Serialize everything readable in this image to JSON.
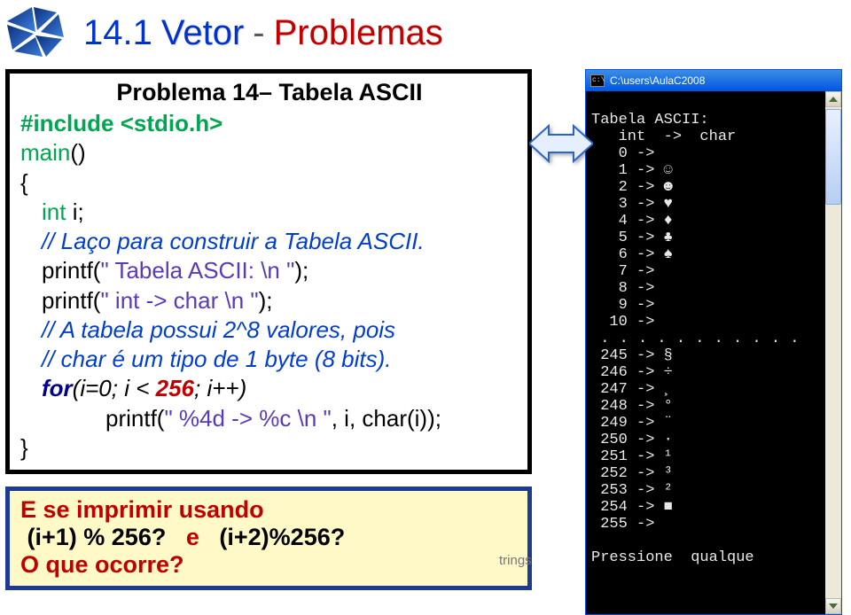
{
  "header": {
    "section_num": "14.1",
    "word_vetor": "Vetor",
    "dash": "-",
    "word_prob": "Problemas"
  },
  "code": {
    "problem_title": "Problema 14– Tabela ASCII",
    "include": "#include <stdio.h>",
    "main_kw": "main",
    "main_paren": "()",
    "brace_open": "{",
    "int_kw": "int",
    "int_var": " i;",
    "cm1": "// Laço para construir a Tabela ASCII.",
    "p1a": "printf(",
    "p1s": "\" Tabela ASCII: \\n \"",
    "p1b": ");",
    "p2a": "printf(",
    "p2s": "\"   int -> char \\n \"",
    "p2b": ");",
    "cm2": "// A tabela possui 2^8 valores, pois",
    "cm3": "// char é um tipo de 1 byte (8 bits).",
    "for_a": "for",
    "for_paren_open": "(i=0; i < ",
    "for_num": "256",
    "for_paren_close": "; i++)",
    "p3a": "printf(",
    "p3s": "\" %4d -> %c \\n \"",
    "p3b": ", i, char(i));",
    "brace_close": "}"
  },
  "question": {
    "l1a": "E se imprimir usando",
    "l2a": "(i+1) % 256?",
    "l2b": "e",
    "l2c": "(i+2)%256?",
    "l3": "O que ocorre?"
  },
  "console": {
    "title": "C:\\users\\AulaC2008",
    "lines_top": [
      "Tabela ASCII:",
      "   int  ->  char",
      "   0 ->",
      "   1 -> ☺",
      "   2 -> ☻",
      "   3 -> ♥",
      "   4 -> ♦",
      "   5 -> ♣",
      "   6 -> ♠",
      "   7 ->",
      "   8 ->",
      "   9 ->",
      "  10 ->"
    ],
    "dots": ". . . . . . . . . . .",
    "lines_bottom": [
      " 245 -> §",
      " 246 -> ÷",
      " 247 -> ¸",
      " 248 -> °",
      " 249 -> ¨",
      " 250 -> ·",
      " 251 -> ¹",
      " 252 -> ³",
      " 253 -> ²",
      " 254 -> ■",
      " 255 ->"
    ],
    "press": "Pressione  qualque"
  },
  "footer": "trings"
}
